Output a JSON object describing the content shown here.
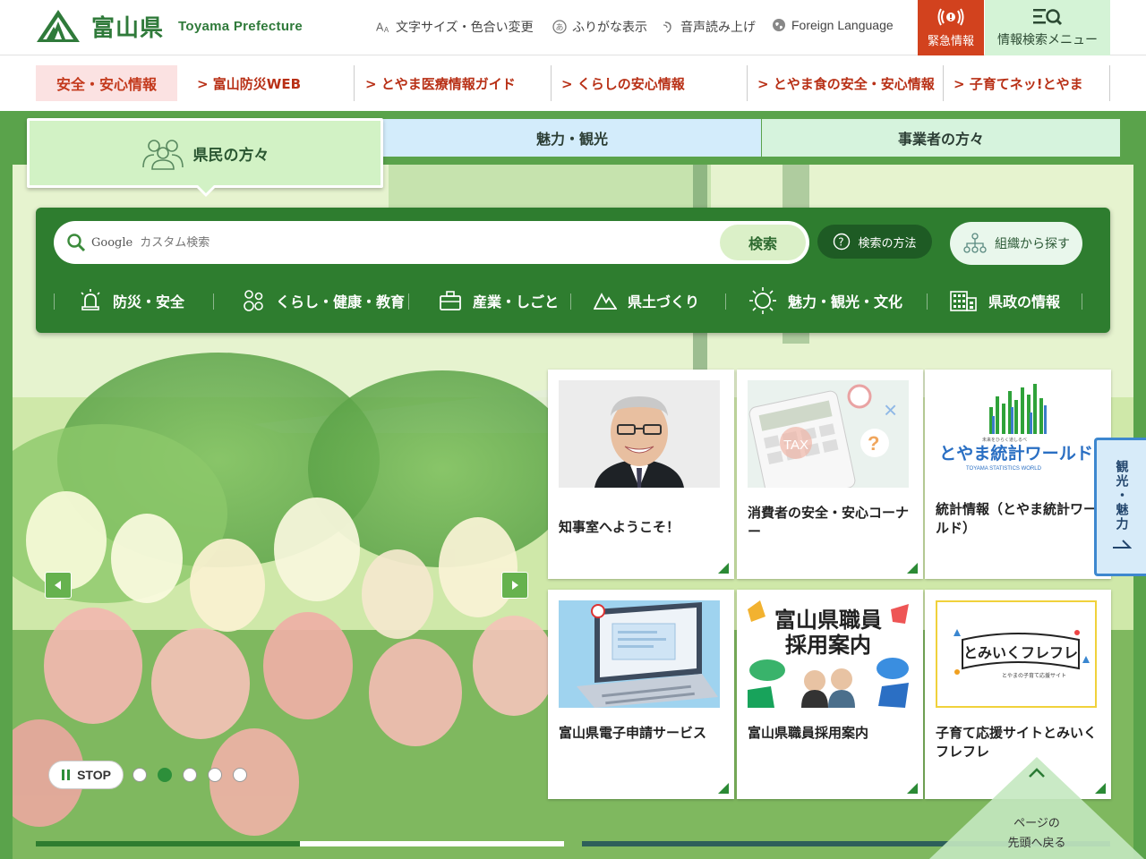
{
  "header": {
    "logo_ja": "富山県",
    "logo_en": "Toyama Prefecture",
    "font_size_label": "文字サイズ・色合い変更",
    "furigana_label": "ふりがな表示",
    "speech_label": "音声読み上げ",
    "foreign_label": "Foreign Language",
    "emergency_label": "緊急情報",
    "search_menu_label": "情報検索メニュー"
  },
  "safety_nav": {
    "active": "安全・安心情報",
    "links": [
      "> 富山防災WEB",
      "> とやま医療情報ガイド",
      "> くらしの安心情報",
      "> とやま食の安全・安心情報",
      "> 子育てネッ!とやま"
    ]
  },
  "tabs": [
    "県民の方々",
    "魅力・観光",
    "事業者の方々"
  ],
  "search": {
    "google_label": "Google",
    "placeholder": "カスタム検索",
    "button": "検索",
    "howto": "検索の方法",
    "org": "組織から探す"
  },
  "categories": [
    "防災・安全",
    "くらし・健康・教育",
    "産業・しごと",
    "県土づくり",
    "魅力・観光・文化",
    "県政の情報"
  ],
  "carousel": {
    "stop_label": "STOP",
    "dot_count": 5,
    "active_dot": 2
  },
  "cards": [
    {
      "title": "知事室へようこそ！"
    },
    {
      "title": "消費者の安全・安心コーナー",
      "image_text": "TAX"
    },
    {
      "title": "統計情報（とやま統計ワールド）",
      "image_text": "とやま統計ワールド",
      "image_sub": "未来をひらく道しるべ",
      "image_en": "TOYAMA STATISTICS WORLD"
    },
    {
      "title": "富山県電子申請サービス"
    },
    {
      "title": "富山県職員採用案内",
      "image_text_1": "富山県職員",
      "image_text_2": "採用案内"
    },
    {
      "title": "子育て応援サイトとみいくフレフレ",
      "image_text": "とみいくフレフレ",
      "image_sub": "とやまの子育て応援サイト"
    }
  ],
  "side_tab": {
    "label": "観光・魅力"
  },
  "to_top": {
    "line1": "ページの",
    "line2": "先頭へ戻る"
  },
  "progress": {
    "fill_fraction": 0.5
  },
  "colors": {
    "brand_green": "#2f7a3a",
    "emergency": "#d2421e",
    "accent_red": "#c3391c"
  }
}
